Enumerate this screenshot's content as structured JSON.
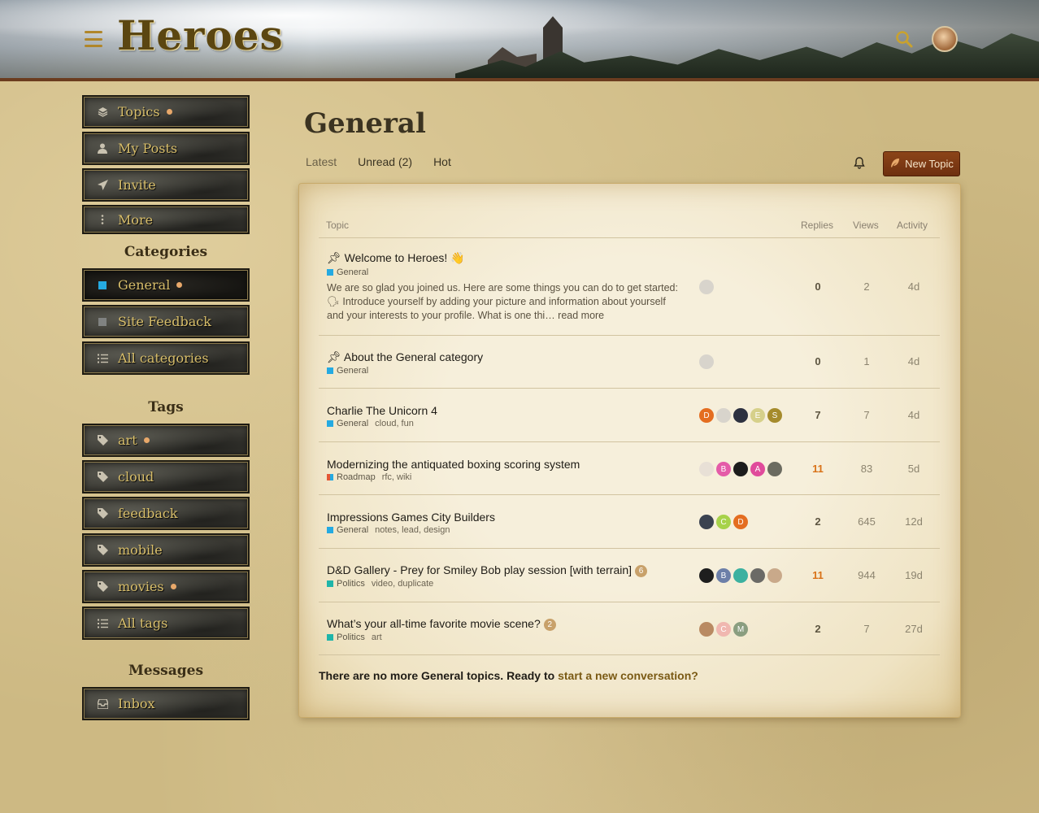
{
  "header": {
    "logo": "Heroes"
  },
  "sidebar": {
    "nav": [
      {
        "label": "Topics",
        "icon": "layers-icon",
        "dot": true
      },
      {
        "label": "My Posts",
        "icon": "user-icon",
        "dot": false
      },
      {
        "label": "Invite",
        "icon": "paper-plane-icon",
        "dot": false
      },
      {
        "label": "More",
        "icon": "ellipsis-vertical-icon",
        "dot": false
      }
    ],
    "categories_heading": "Categories",
    "categories": [
      {
        "label": "General",
        "color": "#25aae1",
        "dot": true
      },
      {
        "label": "Site Feedback",
        "color": "#808281",
        "dot": false
      },
      {
        "label": "All categories",
        "icon": "list-icon",
        "dot": false
      }
    ],
    "tags_heading": "Tags",
    "tags": [
      {
        "label": "art",
        "dot": true
      },
      {
        "label": "cloud",
        "dot": false
      },
      {
        "label": "feedback",
        "dot": false
      },
      {
        "label": "mobile",
        "dot": false
      },
      {
        "label": "movies",
        "dot": true
      },
      {
        "label": "All tags",
        "icon": "list-icon",
        "dot": false
      }
    ],
    "messages_heading": "Messages",
    "messages": [
      {
        "label": "Inbox",
        "icon": "inbox-icon"
      }
    ]
  },
  "main": {
    "title": "General",
    "tabs": [
      "Latest",
      "Unread (2)",
      "Hot"
    ],
    "new_topic": "New Topic",
    "columns": {
      "topic": "Topic",
      "replies": "Replies",
      "views": "Views",
      "activity": "Activity"
    },
    "topics": [
      {
        "title": "Welcome to Heroes! 👋",
        "pinned": true,
        "category": "General",
        "category_color": "#25aae1",
        "tags": "",
        "excerpt": "We are so glad you joined us. Here are some things you can do to get started: 🗣 Introduce yourself by adding your picture and information about yourself and your interests to your profile. What is one thi… read more",
        "replies": "0",
        "views": "2",
        "activity": "4d",
        "hot": false,
        "posters": [
          {
            "letter": "",
            "color": "#d8d4cc"
          }
        ]
      },
      {
        "title": "About the General category",
        "pinned": true,
        "category": "General",
        "category_color": "#25aae1",
        "tags": "",
        "replies": "0",
        "views": "1",
        "activity": "4d",
        "hot": false,
        "posters": [
          {
            "letter": "",
            "color": "#d8d4cc"
          }
        ]
      },
      {
        "title": "Charlie The Unicorn 4",
        "category": "General",
        "category_color": "#25aae1",
        "tags": "cloud, fun",
        "replies": "7",
        "views": "7",
        "activity": "4d",
        "hot": false,
        "posters": [
          {
            "letter": "D",
            "color": "#e46d20"
          },
          {
            "letter": "",
            "color": "#d8d4cc"
          },
          {
            "letter": "",
            "color": "#2d3140"
          },
          {
            "letter": "E",
            "color": "#d6d08a"
          },
          {
            "letter": "S",
            "color": "#a58b2c"
          }
        ]
      },
      {
        "title": "Modernizing the antiquated boxing scoring system",
        "category": "Roadmap",
        "category_color": "#e45735",
        "tags": "rfc, wiki",
        "replies": "11",
        "views": "83",
        "activity": "5d",
        "hot": true,
        "posters": [
          {
            "letter": "",
            "color": "#e8e0d6"
          },
          {
            "letter": "B",
            "color": "#e45ba8"
          },
          {
            "letter": "",
            "color": "#1c1c1c"
          },
          {
            "letter": "A",
            "color": "#e04b9b"
          },
          {
            "letter": "",
            "color": "#6b6b60"
          }
        ]
      },
      {
        "title": "Impressions Games City Builders",
        "category": "General",
        "category_color": "#25aae1",
        "tags": "notes, lead, design",
        "replies": "2",
        "views": "645",
        "activity": "12d",
        "hot": false,
        "posters": [
          {
            "letter": "",
            "color": "#3a4250"
          },
          {
            "letter": "C",
            "color": "#a7d24a"
          },
          {
            "letter": "D",
            "color": "#e46d20"
          }
        ]
      },
      {
        "title": "D&D Gallery - Prey for Smiley Bob play session [with terrain]",
        "badge": "6",
        "category": "Politics",
        "category_color": "#1fb5a9",
        "tags": "video, duplicate",
        "replies": "11",
        "views": "944",
        "activity": "19d",
        "hot": true,
        "posters": [
          {
            "letter": "",
            "color": "#1e1e1e"
          },
          {
            "letter": "B",
            "color": "#6c7fa8"
          },
          {
            "letter": "",
            "color": "#3cb1a0"
          },
          {
            "letter": "",
            "color": "#6b6a66"
          },
          {
            "letter": "",
            "color": "#c9a98a"
          }
        ]
      },
      {
        "title": "What’s your all-time favorite movie scene?",
        "badge": "2",
        "category": "Politics",
        "category_color": "#1fb5a9",
        "tags": "art",
        "replies": "2",
        "views": "7",
        "activity": "27d",
        "hot": false,
        "posters": [
          {
            "letter": "",
            "color": "#b98a62"
          },
          {
            "letter": "C",
            "color": "#f0b7b0"
          },
          {
            "letter": "M",
            "color": "#8a9e80"
          }
        ]
      }
    ],
    "footer_text": "There are no more General topics. Ready to ",
    "footer_link": "start a new conversation?"
  }
}
